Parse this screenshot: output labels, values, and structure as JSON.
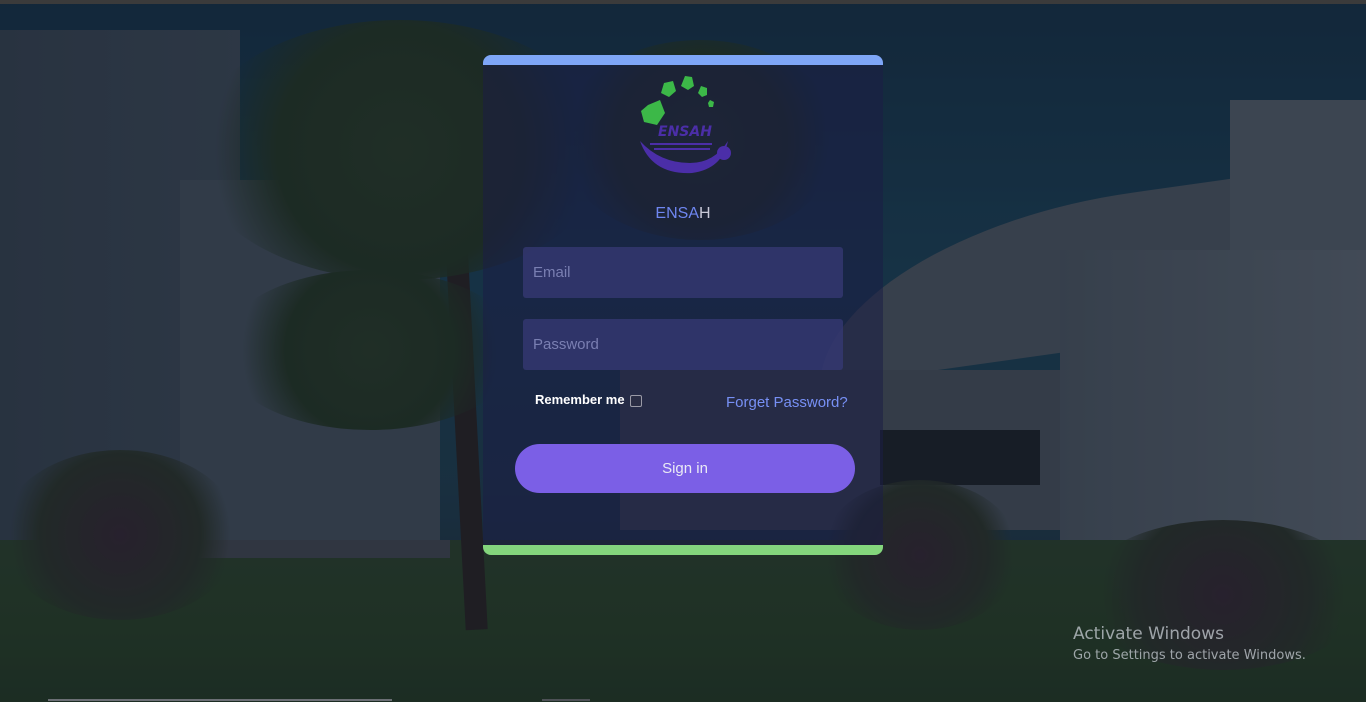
{
  "login": {
    "brand_prefix": "ENSA",
    "brand_suffix": "H",
    "logo_text": "ENSAH",
    "email_placeholder": "Email",
    "password_placeholder": "Password",
    "remember_label": "Remember me",
    "forget_label": "Forget Password?",
    "signin_label": "Sign in"
  },
  "watermark": {
    "title": "Activate Windows",
    "subtitle": "Go to Settings to activate Windows."
  },
  "colors": {
    "top_bar": "#7ea6f7",
    "bottom_bar": "#84d67c",
    "signin_button": "#7b5fe6",
    "link": "#7790f5",
    "logo_green": "#3cb848",
    "logo_purple": "#4b2ea8"
  }
}
